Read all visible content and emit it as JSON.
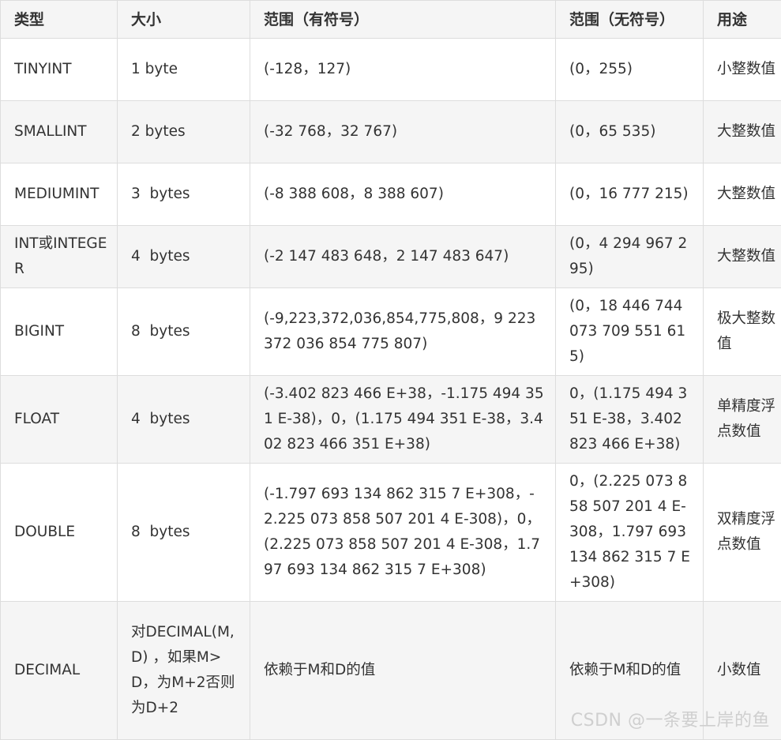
{
  "headers": [
    "类型",
    "大小",
    "范围（有符号）",
    "范围（无符号）",
    "用途"
  ],
  "rows": [
    {
      "type": "TINYINT",
      "size": "1 byte",
      "signed": "(-128，127)",
      "unsigned": "(0，255)",
      "use": "小整数值"
    },
    {
      "type": "SMALLINT",
      "size": "2 bytes",
      "signed": "(-32 768，32 767)",
      "unsigned": "(0，65 535)",
      "use": "大整数值"
    },
    {
      "type": "MEDIUMINT",
      "size": "3  bytes",
      "signed": "(-8 388 608，8 388 607)",
      "unsigned": "(0，16 777 215)",
      "use": "大整数值"
    },
    {
      "type": "INT或INTEGER",
      "size": "4  bytes",
      "signed": "(-2 147 483 648，2 147 483 647)",
      "unsigned": "(0，4 294 967 295)",
      "use": "大整数值"
    },
    {
      "type": "BIGINT",
      "size": "8  bytes",
      "signed": "(-9,223,372,036,854,775,808，9 223 372 036 854 775 807)",
      "unsigned": "(0，18 446 744 073 709 551 615)",
      "use": "极大整数值"
    },
    {
      "type": "FLOAT",
      "size": "4  bytes",
      "signed": "(-3.402 823 466 E+38，-1.175 494 351 E-38)，0，(1.175 494 351 E-38，3.402 823 466 351 E+38)",
      "unsigned": "0，(1.175 494 351 E-38，3.402 823 466 E+38)",
      "use": "单精度浮点数值"
    },
    {
      "type": "DOUBLE",
      "size": "8  bytes",
      "signed": "(-1.797 693 134 862 315 7 E+308，-2.225 073 858 507 201 4 E-308)，0，(2.225 073 858 507 201 4 E-308，1.797 693 134 862 315 7 E+308)",
      "unsigned": "0，(2.225 073 858 507 201 4 E-308，1.797 693 134 862 315 7 E+308)",
      "use": "双精度浮点数值"
    },
    {
      "type": "DECIMAL",
      "size": "对DECIMAL(M,D) ，如果M>D，为M+2否则为D+2",
      "signed": "依赖于M和D的值",
      "unsigned": "依赖于M和D的值",
      "use": "小数值"
    }
  ],
  "watermark": "CSDN @一条要上岸的鱼"
}
